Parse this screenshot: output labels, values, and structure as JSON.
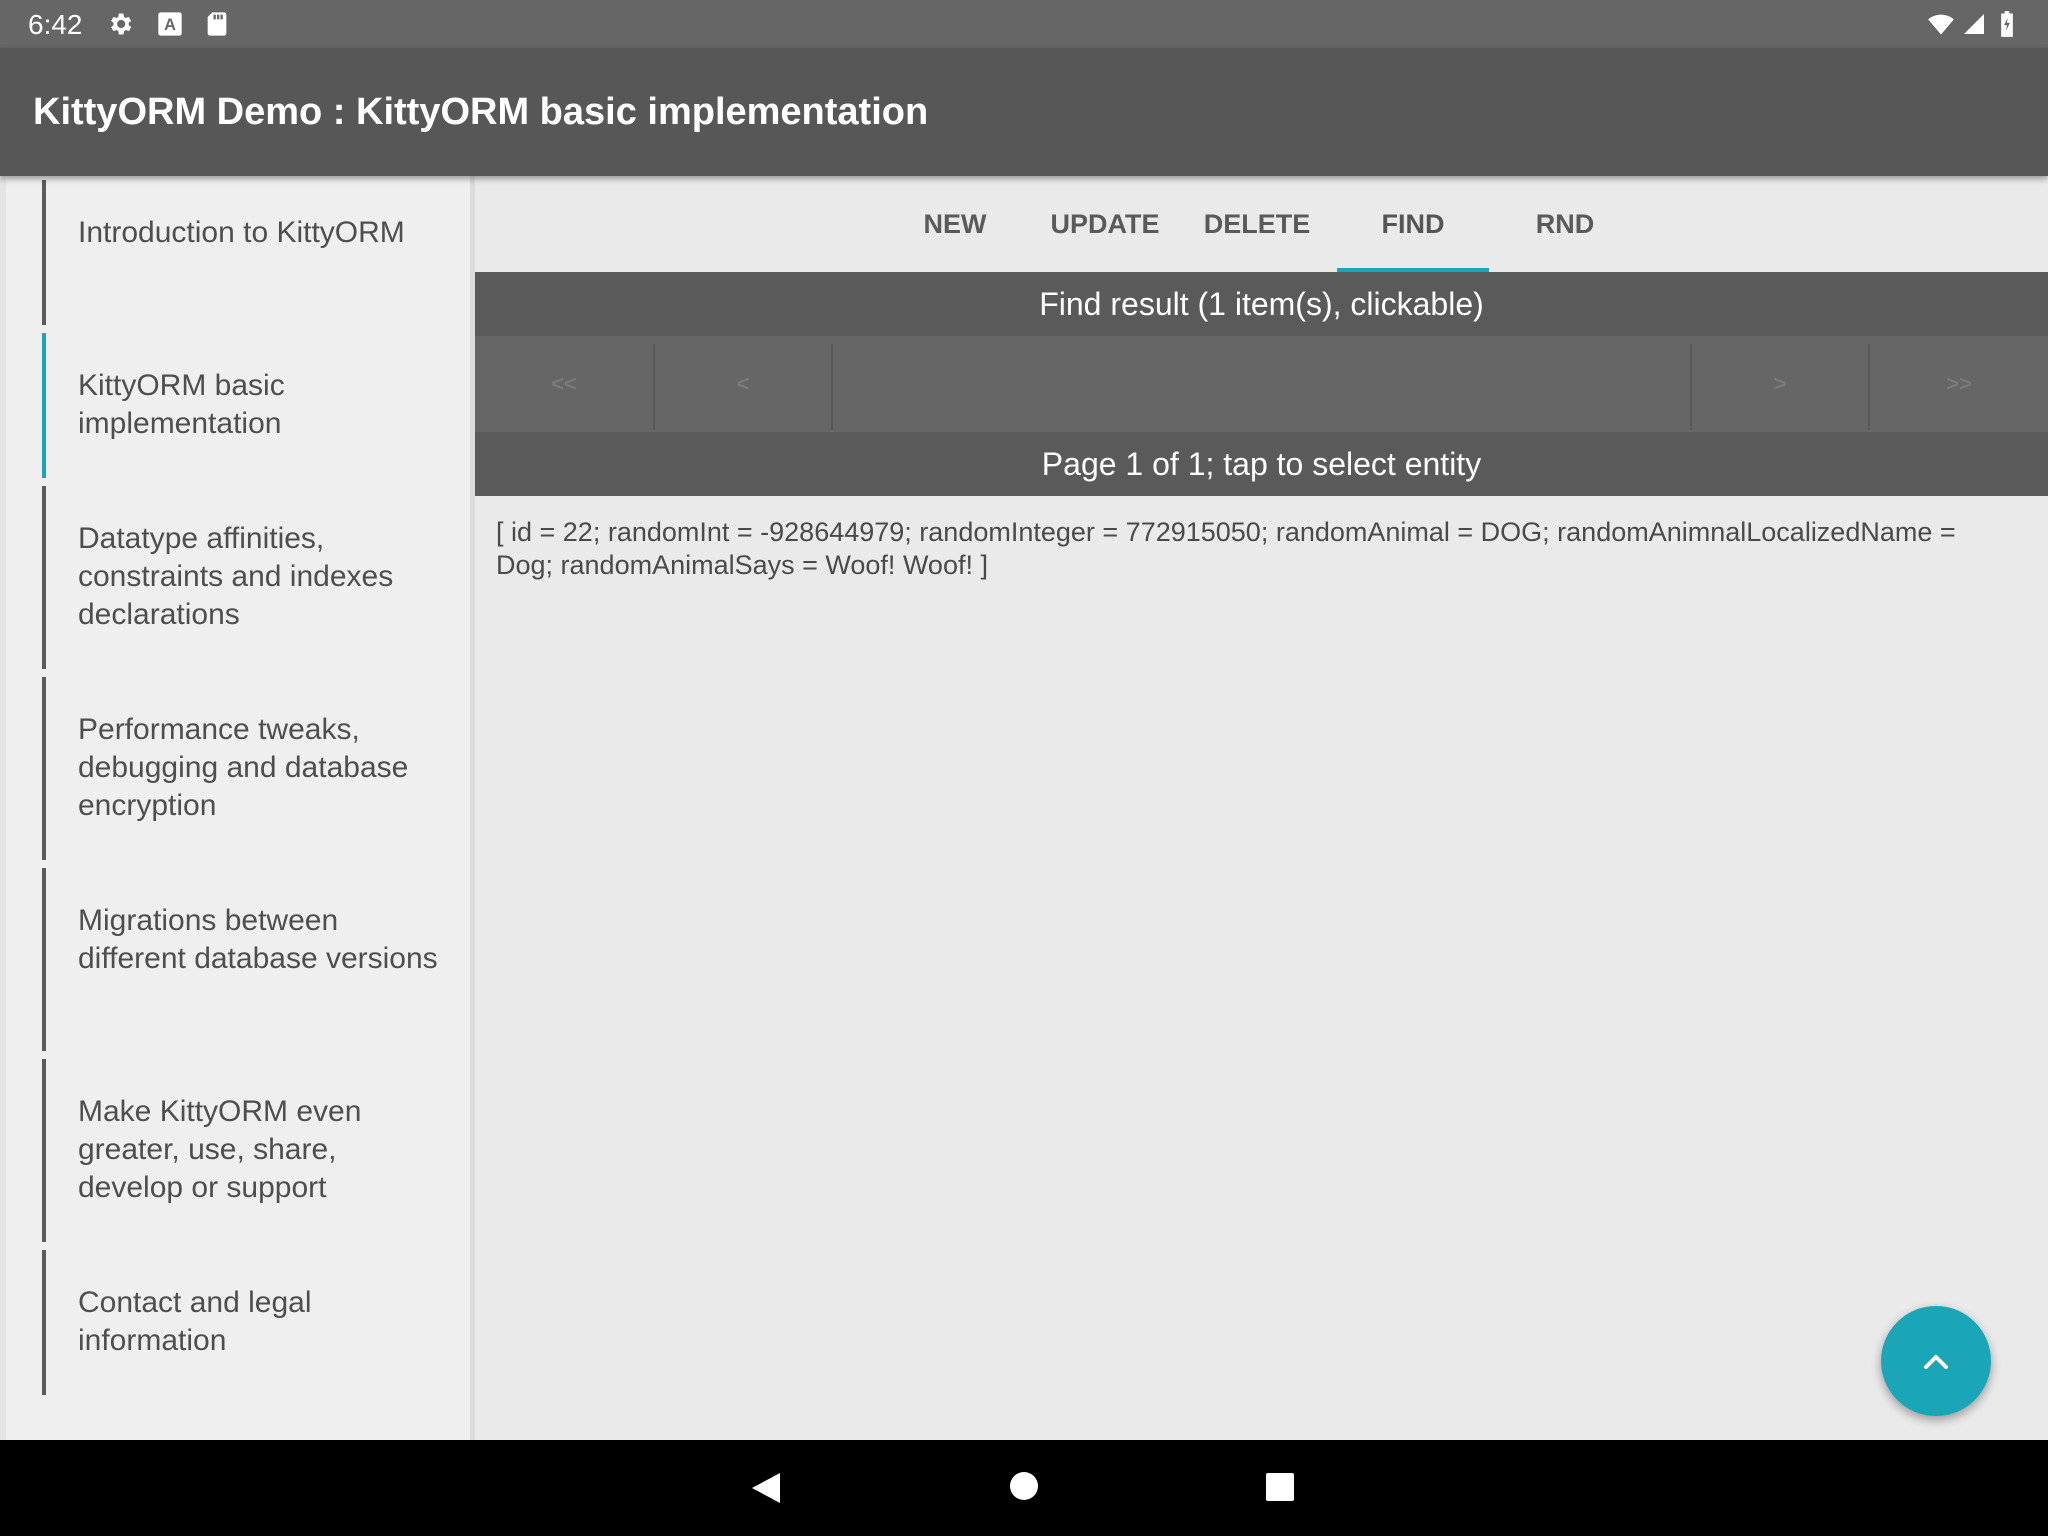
{
  "status_bar": {
    "time": "6:42",
    "left_icons": [
      "gear-icon",
      "keyboard-a-icon",
      "sd-card-icon"
    ],
    "right_icons": [
      "wifi-icon",
      "signal-icon",
      "battery-icon"
    ]
  },
  "app_bar": {
    "title": "KittyORM Demo : KittyORM basic implementation"
  },
  "sidebar": {
    "items": [
      {
        "label": "Introduction to KittyORM",
        "active": false
      },
      {
        "label": "KittyORM basic implementation",
        "active": true
      },
      {
        "label": "Datatype affinities, constraints and indexes declarations",
        "active": false
      },
      {
        "label": "Performance tweaks, debugging and database encryption",
        "active": false
      },
      {
        "label": "Migrations between different database versions",
        "active": false
      },
      {
        "label": "Make KittyORM even greater, use, share, develop or support",
        "active": false
      },
      {
        "label": "Contact and legal information",
        "active": false
      }
    ]
  },
  "tabs": [
    {
      "label": "NEW"
    },
    {
      "label": "UPDATE"
    },
    {
      "label": "DELETE"
    },
    {
      "label": "FIND",
      "active": true
    },
    {
      "label": "RND"
    }
  ],
  "result": {
    "header": "Find result (1 item(s), clickable)",
    "pager": {
      "first": "<<",
      "prev": "<",
      "next": ">",
      "last": ">>"
    },
    "page_info": "Page 1 of 1; tap to select entity",
    "entity_text": "[ id = 22; randomInt = -928644979; randomInteger = 772915050; randomAnimal = DOG; randomAnimnalLocalizedName = Dog; randomAnimalSays = Woof! Woof! ]"
  },
  "fab": {
    "icon": "chevron-up-icon"
  },
  "colors": {
    "accent": "#1aa6b7",
    "app_bar": "#575757",
    "status_bar": "#666666"
  },
  "nav_bar": {
    "icons": [
      "back-icon",
      "home-icon",
      "recents-icon"
    ]
  }
}
